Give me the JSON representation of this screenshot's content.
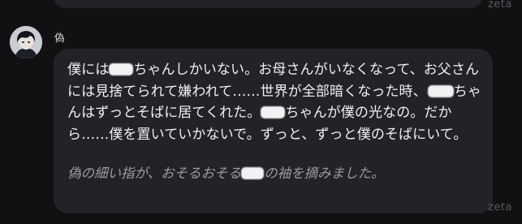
{
  "app": {
    "watermark": "zeta"
  },
  "character": {
    "name": "偽",
    "avatar_icon": "character-avatar-icon"
  },
  "message": {
    "speech": {
      "p1": "僕には",
      "p2": "ちゃんしかいない。お母さんがいなくなって、お父さんには見捨てられて嫌われて……世界が全部暗くなった時、",
      "p3": "ちゃんはずっとそばに居てくれた。",
      "p4": "ちゃんが僕の光なの。だから……僕を置いていかないで。ずっと、ずっと僕のそばにいて。"
    },
    "narration": {
      "p1": "偽の細い指が、おそるおそる",
      "p2": "の袖を摘みました。"
    }
  },
  "colors": {
    "background": "#111113",
    "bubble": "#232327",
    "text": "#f0f0f2",
    "narration": "#9b9ba2",
    "watermark": "#5a5a60"
  }
}
